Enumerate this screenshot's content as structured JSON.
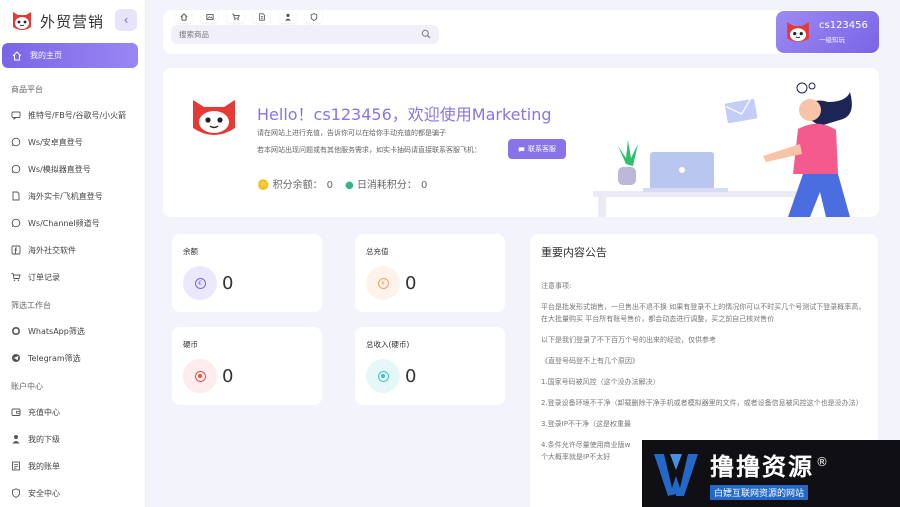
{
  "brand": {
    "name": "外贸营销",
    "collapse_icon": "chevron-left-icon"
  },
  "nav": {
    "home": "我的主页",
    "sections": [
      {
        "title": "商品平台"
      },
      {
        "title": "筛选工作台"
      },
      {
        "title": "账户中心"
      }
    ],
    "product_items": [
      {
        "label": "推特号/FB号/谷歌号/小火箭",
        "icon": "chat-icon"
      },
      {
        "label": "Ws/安卓直登号",
        "icon": "whatsapp-icon"
      },
      {
        "label": "Ws/模拟器直登号",
        "icon": "whatsapp-icon"
      },
      {
        "label": "海外实卡/飞机直登号",
        "icon": "document-icon"
      },
      {
        "label": "Ws/Channel频道号",
        "icon": "whatsapp-icon"
      },
      {
        "label": "海外社交软件",
        "icon": "facebook-icon"
      },
      {
        "label": "订单记录",
        "icon": "cart-icon"
      }
    ],
    "filter_items": [
      {
        "label": "WhatsApp筛选",
        "icon": "whatsapp-icon"
      },
      {
        "label": "Telegram筛选",
        "icon": "telegram-icon"
      }
    ],
    "account_items": [
      {
        "label": "充值中心",
        "icon": "wallet-icon"
      },
      {
        "label": "我的下级",
        "icon": "users-icon"
      },
      {
        "label": "我的账单",
        "icon": "bill-icon"
      },
      {
        "label": "安全中心",
        "icon": "shield-icon"
      }
    ]
  },
  "topbar": {
    "tabs": [
      "home-icon",
      "image-icon",
      "cart-icon",
      "document-icon",
      "user-icon",
      "shield-icon"
    ],
    "search_placeholder": "搜索商品"
  },
  "user": {
    "name": "cs123456",
    "level": "一级知玩"
  },
  "welcome": {
    "hello": "Hello！cs123456，欢迎使用Marketing",
    "tip1": "请在网站上进行充值，告诉你可以在给你手动充值的都是骗子",
    "tip2": "若本网站出现问题或有其他服务需求，如实卡抽码请直接联系客服飞机：",
    "contact_button": "联系客服",
    "points_label": "积分余额：",
    "points_value": "0",
    "daily_label": "日消耗积分：",
    "daily_value": "0"
  },
  "stats": [
    {
      "label": "余额",
      "value": "0",
      "color": "#7b65e8",
      "bg": "#ece8fb",
      "glyph": "€"
    },
    {
      "label": "总充值",
      "value": "0",
      "color": "#f1a15b",
      "bg": "#fdf3ea",
      "glyph": "✦"
    },
    {
      "label": "硬币",
      "value": "0",
      "color": "#e5504f",
      "bg": "#fdecec",
      "glyph": "◉"
    },
    {
      "label": "总收入(硬币)",
      "value": "0",
      "color": "#3cc0c8",
      "bg": "#e6f7f8",
      "glyph": "◎"
    }
  ],
  "notice": {
    "title": "重要内容公告",
    "paragraphs": [
      "注意事项:",
      "平台是批发形式销售，一旦售出不退不换 如果有登录不上的情况你可以不时买几个号测试下登录概率高，在大批量购买 平台所有账号售价，都会动态进行调整，买之前自己核对售价",
      "以下是我们登录了不下百万个号的出来的经验，仅供参考",
      "《直登号码登不上有几个原因》",
      "1.国家号码被风控（这个没办法解决）",
      "2.登录设备环境不干净（卸载删除干净手机或者模拟器里的文件，或者设备信息被风控这个也是没办法）",
      "3.登录IP不干净（这是权重最",
      "4.条件允许尽量使用商业版w",
      "个大概率就是IP不太好"
    ]
  },
  "watermark": {
    "title": "撸撸资源",
    "mark": "®",
    "subtitle": "白嫖互联网资源的网站"
  }
}
